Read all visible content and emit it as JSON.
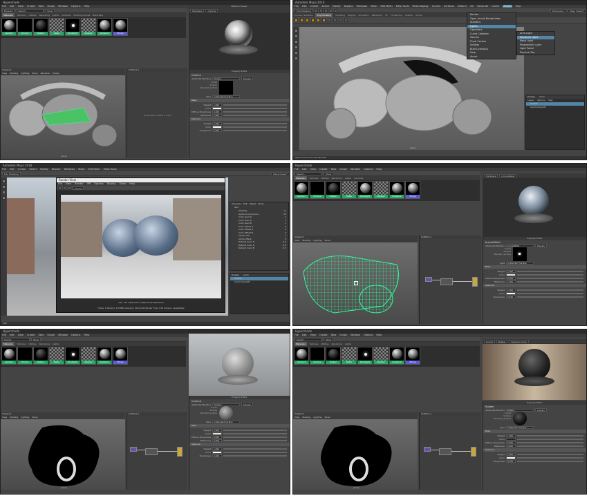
{
  "menus_main": [
    "File",
    "Edit",
    "Create",
    "Select",
    "Modify",
    "Display",
    "Windows",
    "Mesh",
    "Edit Mesh",
    "Mesh Tools",
    "Mesh Display",
    "Curves",
    "Surfaces",
    "Deform",
    "UV",
    "Generate",
    "Cache",
    "Arnold",
    "Help"
  ],
  "menus_hs": [
    "File",
    "Edit",
    "View",
    "Create",
    "Tabs",
    "Graph",
    "Window",
    "Options",
    "Help"
  ],
  "hs_title": "Hypershade",
  "viewport_label": "Viewport",
  "viewport_menus": [
    "View",
    "Shading",
    "Lighting",
    "Show",
    "Renderer",
    "Panels"
  ],
  "cam_label": "persp",
  "property_editor": "Property Editor",
  "material_viewer": "Material Viewer",
  "browser": "Browser",
  "materials_tab": "Materials",
  "tabs": [
    "Textures",
    "Utilities",
    "Rendering",
    "Lights",
    "Cameras",
    "Shading Groups",
    "Bake Sets",
    "Projects",
    "Asset Nodes"
  ],
  "work_area": "Untitled_1",
  "work_hint": "Press Tab to create a node",
  "swatches": [
    "Lambert",
    "Chrome",
    "Rubber",
    "Metal",
    "PointLight",
    "Sampler",
    "Sampler2",
    "Phong"
  ],
  "shelf_tabs": [
    "Curves / Surfaces",
    "Poly Modeling",
    "Sculpting",
    "Rigging",
    "Animation",
    "Rendering",
    "FX",
    "FX Caching",
    "Custom",
    "Arnold",
    "Bifrost",
    "MASH",
    "Motion Graphics",
    "XGen"
  ],
  "workspace": "Workspace:",
  "workspace_val": "Maya Classic*",
  "tr_title": "Autodesk Maya 2018",
  "arnold_menu": [
    "Render",
    "Open Arnold RenderView",
    "Standins",
    "Lights",
    "Operators",
    "Curve Collector",
    "Volume",
    "Flush Caches",
    "Utilities",
    "BUM Licensing",
    "Help",
    "About"
  ],
  "arnold_sub": [
    "Area Light",
    "Skydome Light",
    "Mesh Light",
    "Photometric Light",
    "Light Portal",
    "Physical Sky"
  ],
  "outliner_tabs": [
    "Display",
    "Anim"
  ],
  "outliner_menus": [
    "Layers",
    "Options",
    "Help"
  ],
  "outliner_items": [
    "helmet",
    "skydomeLight1"
  ],
  "status_text": "Opens the Arnold RenderView",
  "shelf_mid": "Poly Modeling",
  "render_view": "Render View",
  "render_menus": [
    "File",
    "View",
    "Render",
    "IPR",
    "Options",
    "Display",
    "Show",
    "Help"
  ],
  "render_info": "size: 712 x 480 zoom: 0.680  (Arnold Renderer)",
  "render_frame": "Frame: 1    Memory: 1704Mb    Sampling: [3/2/2/2/2]    Render Time: 0:03    Camera: perspShape",
  "channel_tabs": [
    "Channels",
    "Edit",
    "Object",
    "Show"
  ],
  "channel_obj": "lbs1",
  "channel_rows": [
    "Visibility",
    "Alpha Is Luminance",
    "Color Gain R",
    "Color Gain G",
    "Color Gain B",
    "Color Offset R",
    "Color Offset G",
    "Color Offset B",
    "Alpha Gain",
    "Alpha Offset",
    "Default Color R",
    "Default Color G",
    "Default Color B"
  ],
  "channel_vals": [
    "on",
    "off",
    "1",
    "1",
    "1",
    "0",
    "0",
    "0",
    "1",
    "0",
    "0.5",
    "0.5",
    "0.5"
  ],
  "p1": {
    "shader": "aiStandardSurface",
    "name": "Chrome",
    "presets": "Presets",
    "type_label": "Type",
    "type": "ai Standard Surface",
    "sections": [
      "Base",
      "Specular"
    ],
    "rows": [
      "Weight",
      "Color",
      "Diffuse Roughness",
      "Metalness"
    ],
    "vals": [
      "1.000",
      "",
      "0.000",
      "1.000"
    ],
    "spec_rows": [
      "Weight",
      "Color",
      "Roughness"
    ],
    "spec_vals": [
      "1.000",
      "",
      "0.000"
    ],
    "swatch_text": [
      "Arnold",
      "Surface",
      "Standard_surface"
    ]
  },
  "p4": {
    "name": "bronzeMetal",
    "rows": [
      "Weight",
      "Color",
      "Diffuse Roughness",
      "Metalness"
    ],
    "vals": [
      "1.000",
      "",
      "0.000",
      "1.000"
    ],
    "spec_vals": [
      "1.000",
      "",
      "0.250"
    ]
  },
  "p5": {
    "name": "Ceramic",
    "rows": [
      "Weight",
      "Color",
      "Diffuse Roughness",
      "Metalness"
    ],
    "vals": [
      "1.000",
      "",
      "0.000",
      "0.000"
    ],
    "spec_vals": [
      "1.000",
      "",
      "0.200"
    ]
  },
  "p6": {
    "name": "Rubber",
    "rows": [
      "Weight",
      "Color",
      "Diffuse Roughness",
      "Metalness"
    ],
    "vals": [
      "1.000",
      "",
      "0.000",
      "0.000"
    ],
    "spec_vals": [
      "1.000",
      "",
      "0.500"
    ]
  },
  "search_ph": "Search...",
  "show": "Show",
  "arnold": "Arnold",
  "sel_color": "Selection Color",
  "renderer": "Hardware",
  "mel": "MEL",
  "colors": {
    "green": "#22aa66",
    "purple": "#5b5bd6",
    "highlight": "#5285a6",
    "wire": "#2dff9a"
  }
}
